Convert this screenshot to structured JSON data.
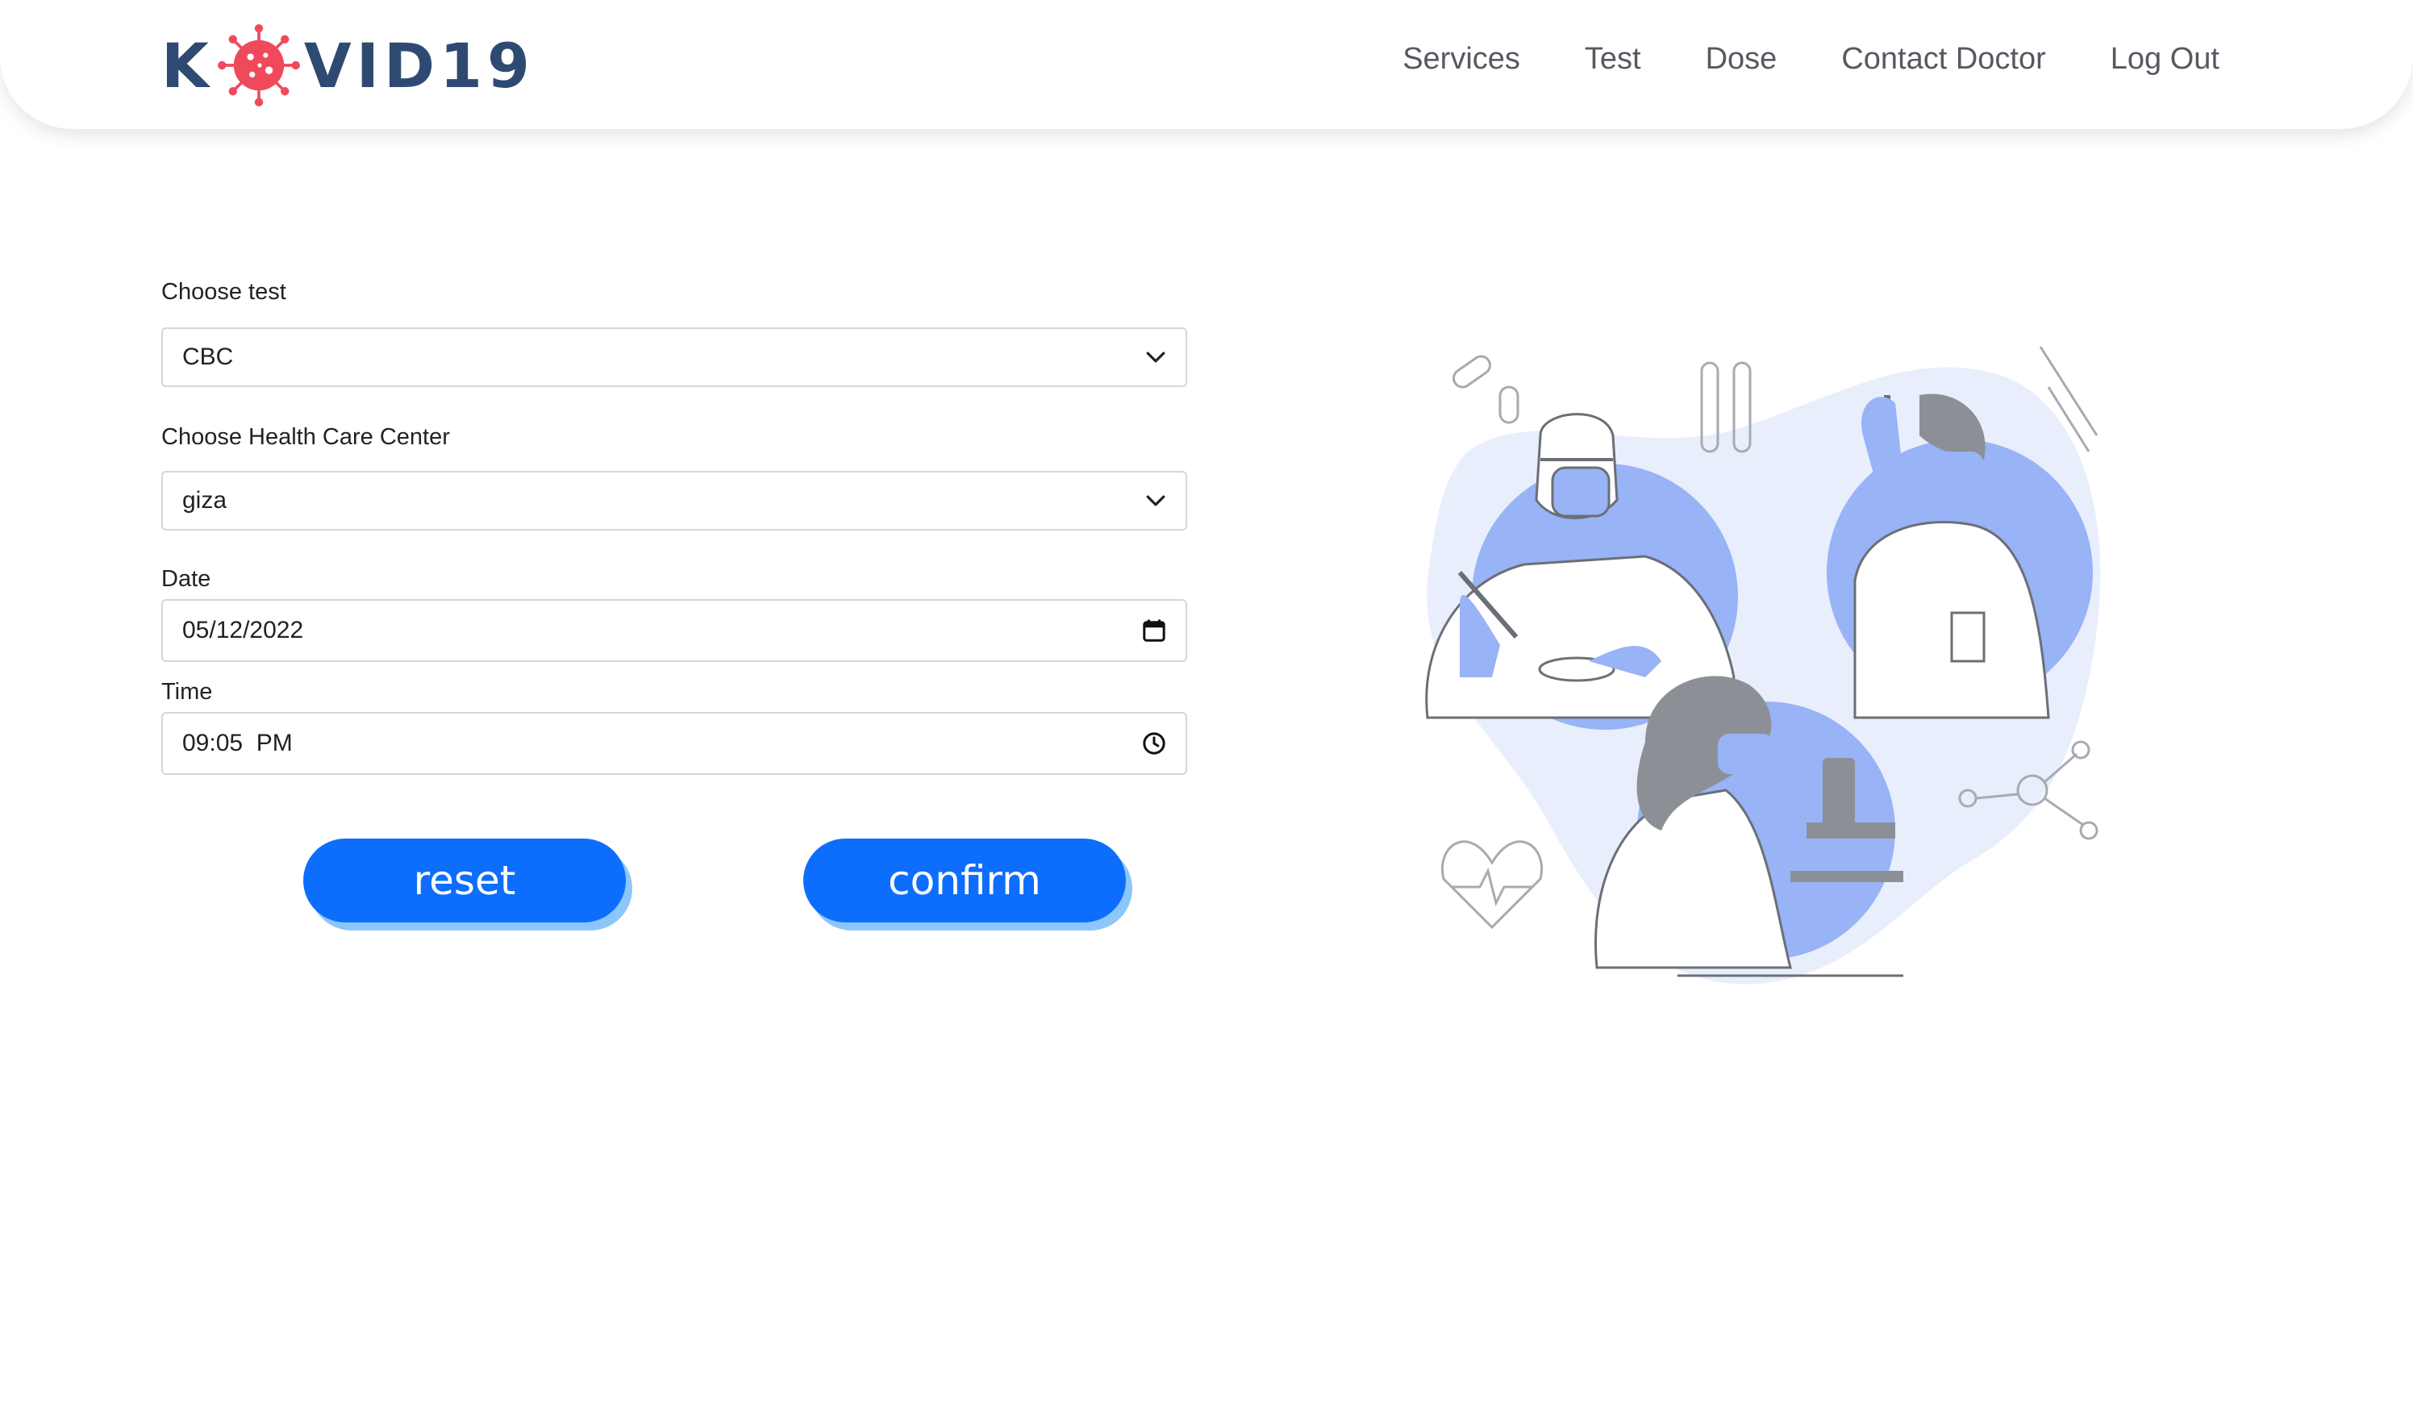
{
  "brand": {
    "logo_prefix": "K",
    "logo_suffix": "VID19",
    "logo_color": "#2f4a72",
    "virus_color": "#ef4a5b"
  },
  "nav": {
    "items": [
      {
        "label": "Services"
      },
      {
        "label": "Test"
      },
      {
        "label": "Dose"
      },
      {
        "label": "Contact Doctor"
      },
      {
        "label": "Log Out"
      }
    ]
  },
  "form": {
    "test": {
      "label": "Choose test",
      "value": "CBC"
    },
    "center": {
      "label": "Choose Health Care Center",
      "value": "giza"
    },
    "date": {
      "label": "Date",
      "value": "05/12/2022"
    },
    "time": {
      "label": "Time",
      "value": "09:05  PM"
    }
  },
  "actions": {
    "reset_label": "reset",
    "confirm_label": "confirm",
    "button_color": "#0d6efd",
    "button_shadow_color": "#8cc6fa"
  },
  "illustration": {
    "accent_color": "#98b3f6",
    "background_color": "#e8eefc"
  }
}
